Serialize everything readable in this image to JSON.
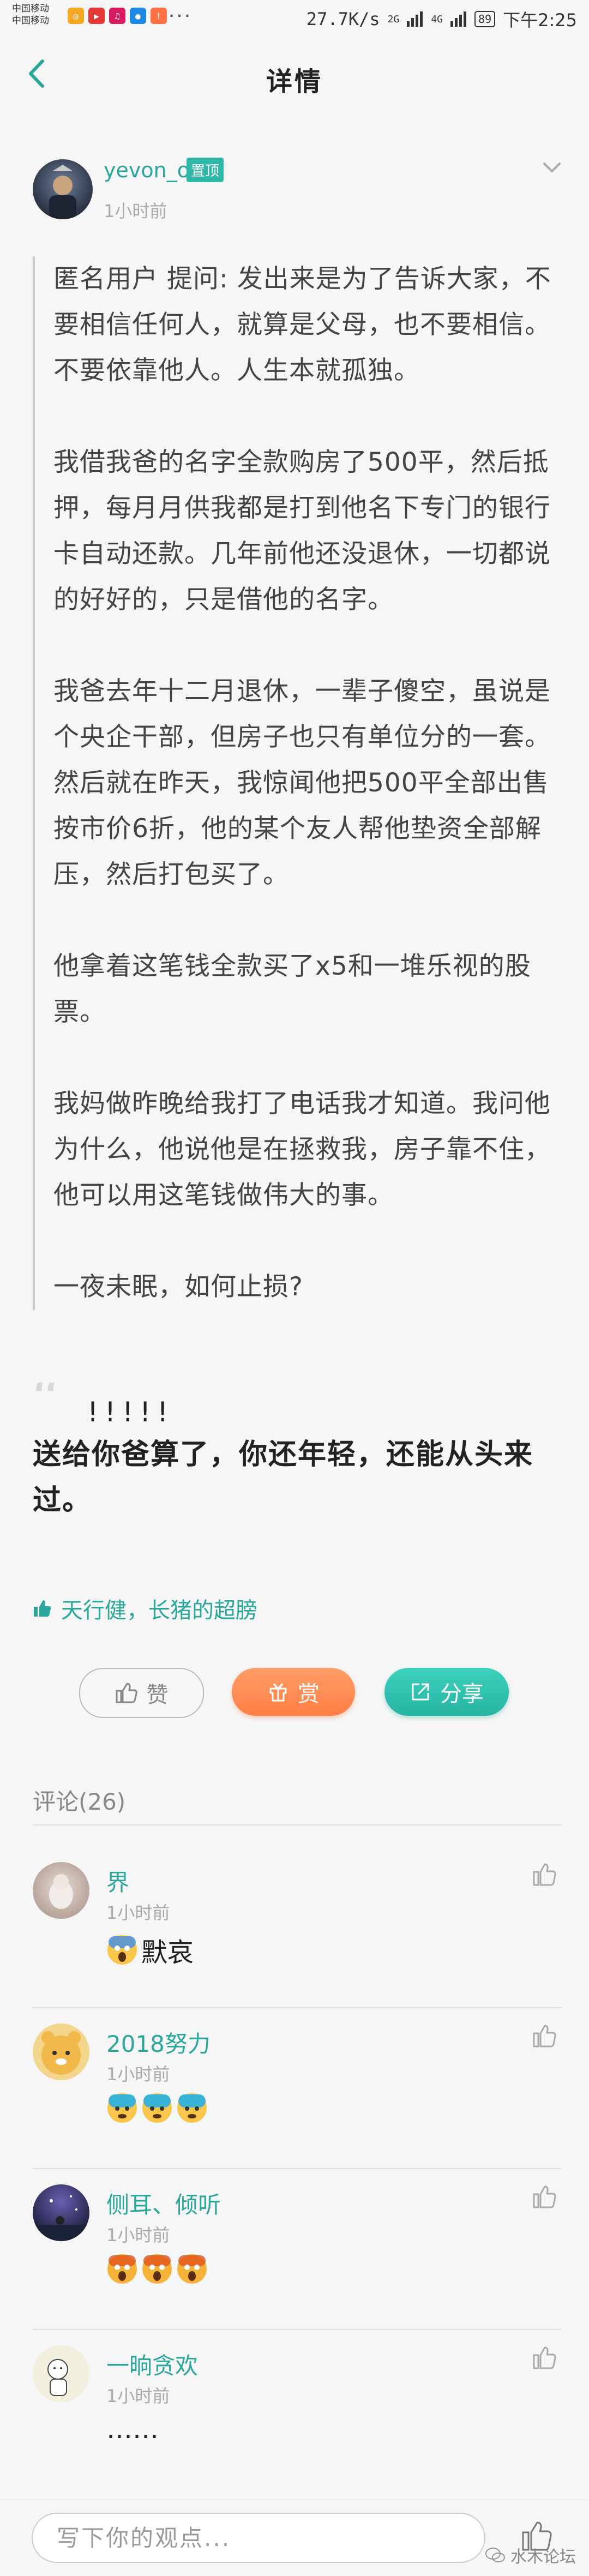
{
  "status_bar": {
    "carrier_1": "中国移动",
    "carrier_2": "中国移动",
    "speed": "27.7K/s",
    "net_1": "2G",
    "net_2": "4G",
    "battery": "89",
    "time": "下午2:25"
  },
  "nav": {
    "title": "详情"
  },
  "post": {
    "author": "yevon_ou",
    "badge": "置顶",
    "time": "1小时前",
    "question": [
      "匿名用户 提问: 发出来是为了告诉大家，不要相信任何人，就算是父母，也不要相信。不要依靠他人。人生本就孤独。",
      "我借我爸的名字全款购房了500平，然后抵押，每月月供我都是打到他名下专门的银行卡自动还款。几年前他还没退休，一切都说的好好的，只是借他的名字。",
      "我爸去年十二月退休，一辈子傻空，虽说是个央企干部，但房子也只有单位分的一套。然后就在昨天，我惊闻他把500平全部出售按市价6折，他的某个友人帮他垫资全部解压，然后打包买了。",
      "他拿着这笔钱全款买了x5和一堆乐视的股票。",
      "我妈做昨晚给我打了电话我才知道。我问他为什么，他说他是在拯救我，房子靠不住，他可以用这笔钱做伟大的事。",
      "一夜未眠，如何止损?"
    ],
    "exclaim": "!!!!!",
    "answer": "送给你爸算了，你还年轻，还能从头来过。",
    "likers": "天行健，长猪的超膀"
  },
  "actions": {
    "like_label": "赞",
    "reward_label": "赏",
    "share_label": "分享"
  },
  "comments": {
    "header": "评论(26)",
    "items": [
      {
        "name": "界",
        "time": "1小时前",
        "text": "默哀",
        "emoji": "scream-emoji"
      },
      {
        "name": "2018努力",
        "time": "1小时前",
        "text": "",
        "emoji": "cold-sweat-emoji x3"
      },
      {
        "name": "侧耳、倾听",
        "time": "1小时前",
        "text": "",
        "emoji": "scream-emoji x3"
      },
      {
        "name": "一晌贪欢",
        "time": "1小时前",
        "text": "……",
        "emoji": ""
      }
    ]
  },
  "bottom": {
    "placeholder": "写下你的观点...",
    "watermark": "水木论坛"
  },
  "colors": {
    "accent": "#2aa79b",
    "reward": "#ff8a52",
    "share": "#2fc0ae",
    "background": "#f6f6f6"
  }
}
